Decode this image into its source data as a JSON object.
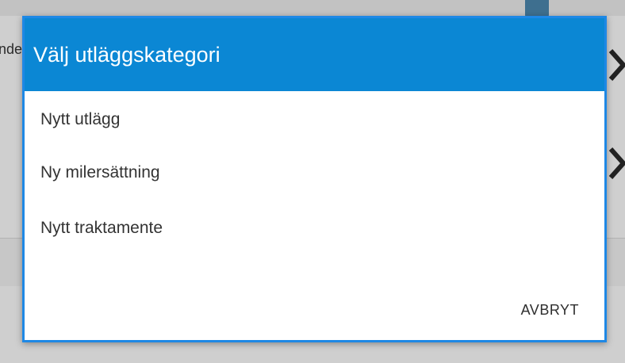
{
  "background": {
    "side_text": "nde"
  },
  "dialog": {
    "title": "Välj utläggskategori",
    "options": [
      {
        "label": "Nytt utlägg"
      },
      {
        "label": "Ny milersättning"
      },
      {
        "label": "Nytt traktamente"
      }
    ],
    "cancel_label": "AVBRYT"
  },
  "colors": {
    "header": "#0b87d4",
    "dialog_border": "#1e88e5",
    "overlay": "#cfcfcf"
  }
}
